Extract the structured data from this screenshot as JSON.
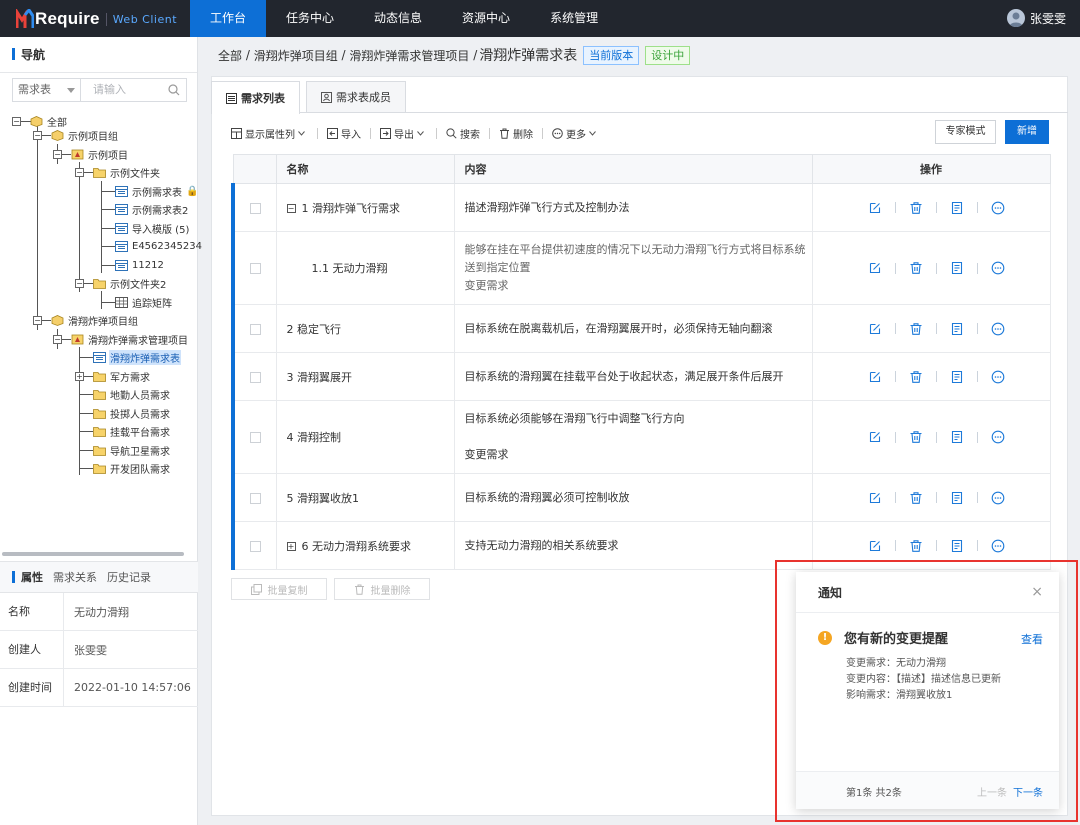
{
  "app": {
    "logo_text": "Require",
    "logo_sub": "Web Client",
    "brand_color": "#0d6fd6"
  },
  "nav": {
    "tabs": [
      "工作台",
      "任务中心",
      "动态信息",
      "资源中心",
      "系统管理"
    ],
    "active": 0
  },
  "user": {
    "name": "张雯雯"
  },
  "sidebar": {
    "title": "导航",
    "search": {
      "select_value": "需求表",
      "placeholder": "请输入"
    },
    "tree": {
      "root": "全部",
      "g1": "示例项目组",
      "p1": "示例项目",
      "f1": "示例文件夹",
      "f1_items": [
        "示例需求表",
        "示例需求表2",
        "导入模版 (5)",
        "E4562345234",
        "11212"
      ],
      "f2": "示例文件夹2",
      "f2_items": [
        "追踪矩阵"
      ],
      "g2": "滑翔炸弹项目组",
      "p2": "滑翔炸弹需求管理项目",
      "p2_items": [
        "滑翔炸弹需求表",
        "军方需求",
        "地勤人员需求",
        "投掷人员需求",
        "挂载平台需求",
        "导航卫星需求",
        "开发团队需求"
      ]
    }
  },
  "properties": {
    "tabs": [
      "属性",
      "需求关系",
      "历史记录"
    ],
    "rows": [
      {
        "key": "名称",
        "value": "无动力滑翔"
      },
      {
        "key": "创建人",
        "value": "张雯雯"
      },
      {
        "key": "创建时间",
        "value": "2022-01-10 14:57:06"
      }
    ]
  },
  "breadcrumb": {
    "items": [
      "全部",
      "滑翔炸弹项目组",
      "滑翔炸弹需求管理项目"
    ],
    "current": "滑翔炸弹需求表",
    "tag_version": "当前版本",
    "tag_status": "设计中"
  },
  "content_tabs": [
    "需求列表",
    "需求表成员"
  ],
  "toolbar": {
    "columns": "显示属性列",
    "import": "导入",
    "export": "导出",
    "search": "搜索",
    "delete": "删除",
    "more": "更多",
    "expert": "专家模式",
    "new": "新增"
  },
  "table": {
    "headers": [
      "名称",
      "内容",
      "操作"
    ],
    "rows": [
      {
        "name": "1 滑翔炸弹飞行需求",
        "content": [
          "描述滑翔炸弹飞行方式及控制办法"
        ]
      },
      {
        "name": "1.1 无动力滑翔",
        "content": [
          "能够在挂在平台提供初速度的情况下以无动力滑翔飞行方式将目标系统送到指定位置",
          "变更需求"
        ]
      },
      {
        "name": "2 稳定飞行",
        "content": [
          "目标系统在脱离载机后，在滑翔翼展开时，必须保持无轴向翻滚"
        ]
      },
      {
        "name": "3 滑翔翼展开",
        "content": [
          "目标系统的滑翔翼在挂载平台处于收起状态，满足展开条件后展开"
        ]
      },
      {
        "name": "4 滑翔控制",
        "content": [
          "目标系统必须能够在滑翔飞行中调整飞行方向",
          "变更需求"
        ]
      },
      {
        "name": "5 滑翔翼收放1",
        "content": [
          "目标系统的滑翔翼必须可控制收放"
        ]
      },
      {
        "name": "6 无动力滑翔系统要求",
        "content": [
          "支持无动力滑翔的相关系统要求"
        ]
      }
    ]
  },
  "bulk": {
    "copy": "批量复制",
    "delete": "批量删除"
  },
  "notification": {
    "title": "通知",
    "headline": "您有新的变更提醒",
    "view": "查看",
    "lines": [
      "变更需求：无动力滑翔",
      "变更内容：【描述】描述信息已更新",
      "影响需求：滑翔翼收放1"
    ],
    "count": "第1条 共2条",
    "prev": "上一条",
    "next": "下一条"
  }
}
